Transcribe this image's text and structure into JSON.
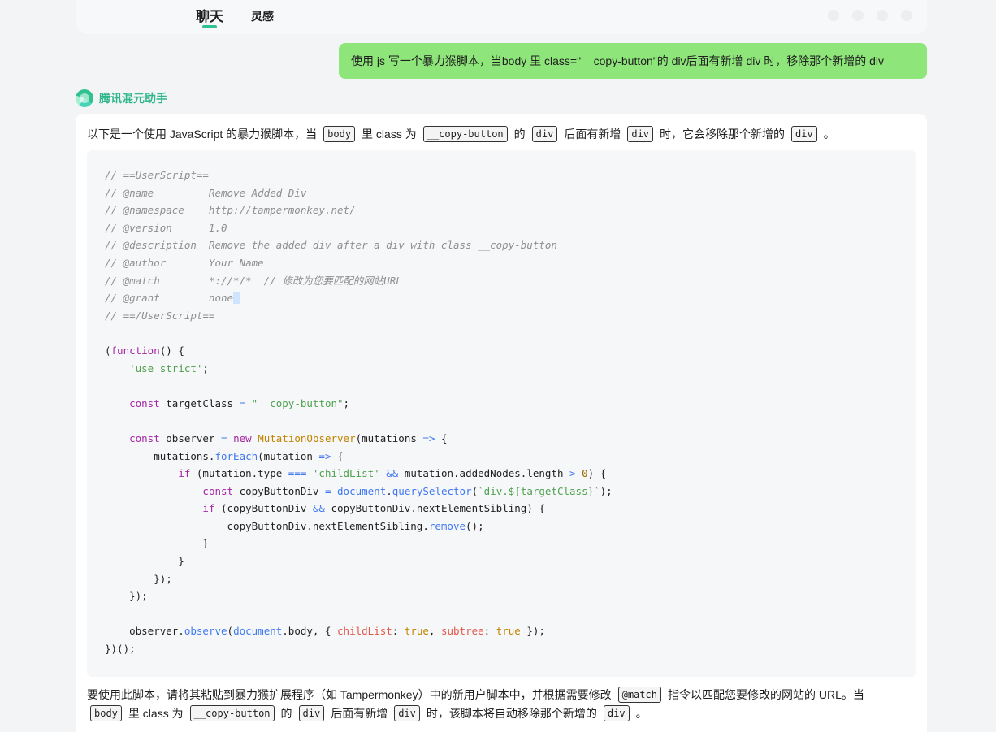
{
  "header": {
    "tabs": [
      {
        "label": "聊天",
        "active": true
      },
      {
        "label": "灵感",
        "active": false
      }
    ]
  },
  "user_message": {
    "text": "使用 js 写一个暴力猴脚本，当body 里 class=\"__copy-button\"的 div后面有新增 div 时，移除那个新增的 div"
  },
  "assistant": {
    "name": "腾讯混元助手",
    "intro": {
      "t1": "以下是一个使用 JavaScript 的暴力猴脚本，当",
      "c1": "body",
      "t2": "里 class 为",
      "c2": "__copy-button",
      "t3": "的",
      "c3": "div",
      "t4": "后面有新增",
      "c4": "div",
      "t5": "时，它会移除那个新增的",
      "c5": "div",
      "t6": "。"
    },
    "code_lines": [
      "// ==UserScript==",
      "// @name         Remove Added Div",
      "// @namespace    http://tampermonkey.net/",
      "// @version      1.0",
      "// @description  Remove the added div after a div with class __copy-button",
      "// @author       Your Name",
      "// @match        *://*/*  // 修改为您要匹配的网站URL",
      "// @grant        none",
      "// ==/UserScript==",
      "",
      "(function() {",
      "    'use strict';",
      "",
      "    const targetClass = \"__copy-button\";",
      "",
      "    const observer = new MutationObserver(mutations => {",
      "        mutations.forEach(mutation => {",
      "            if (mutation.type === 'childList' && mutation.addedNodes.length > 0) {",
      "                const copyButtonDiv = document.querySelector(`div.${targetClass}`);",
      "                if (copyButtonDiv && copyButtonDiv.nextElementSibling) {",
      "                    copyButtonDiv.nextElementSibling.remove();",
      "                }",
      "            }",
      "        });",
      "    });",
      "",
      "    observer.observe(document.body, { childList: true, subtree: true });",
      "})();"
    ],
    "outro": {
      "t1": "要使用此脚本，请将其粘贴到暴力猴扩展程序（如 Tampermonkey）中的新用户脚本中，并根据需要修改",
      "c1": "@match",
      "t2": "指令以匹配您要修改的网站的 URL。当",
      "c2": "body",
      "t3": "里 class 为",
      "c3": "__copy-button",
      "t4": "的",
      "c4": "div",
      "t5": "后面有新增",
      "c5": "div",
      "t6": "时，该脚本将自动移除那个新增的",
      "c6": "div",
      "t7": "。"
    }
  },
  "colors": {
    "user_bubble": "#8ee57a",
    "accent": "#2fc28f",
    "code_background": "#f6f7f8"
  }
}
